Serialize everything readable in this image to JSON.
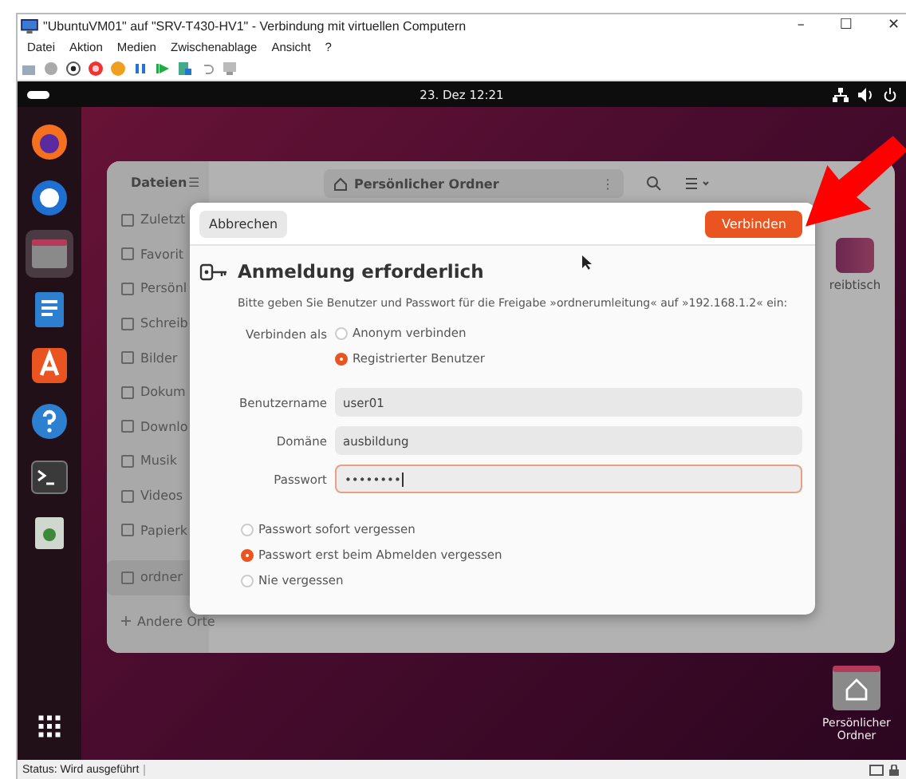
{
  "host_window": {
    "title": "\"UbuntuVM01\" auf \"SRV-T430-HV1\" - Verbindung mit virtuellen Computern",
    "controls": [
      "–",
      "☐",
      "✕"
    ]
  },
  "menu": [
    "Datei",
    "Aktion",
    "Medien",
    "Zwischenablage",
    "Ansicht",
    "?"
  ],
  "topbar": {
    "clock": "23. Dez  12:21"
  },
  "files_window": {
    "title": "Dateien",
    "menu_glyph": "☰",
    "path": "Persönlicher Ordner",
    "more_glyph": "⋮",
    "sidebar": [
      {
        "label": "Zuletzt",
        "selected": false
      },
      {
        "label": "Favorit",
        "selected": false
      },
      {
        "label": "Persönl",
        "selected": false
      },
      {
        "label": "Schreib",
        "selected": false
      },
      {
        "label": "Bilder",
        "selected": false
      },
      {
        "label": "Dokum",
        "selected": false
      },
      {
        "label": "Downlo",
        "selected": false
      },
      {
        "label": "Musik",
        "selected": false
      },
      {
        "label": "Videos",
        "selected": false
      },
      {
        "label": "Papierk",
        "selected": false
      },
      {
        "label": "ordner",
        "selected": true
      }
    ],
    "other_places": "Andere Orte",
    "content_item": "reibtisch"
  },
  "dialog": {
    "cancel": "Abbrechen",
    "confirm": "Verbinden",
    "title": "Anmeldung erforderlich",
    "message": "Bitte geben Sie Benutzer und Passwort für die Freigabe »ordnerumleitung« auf »192.168.1.2« ein:",
    "connect_as_label": "Verbinden als",
    "connect_as": [
      {
        "label": "Anonym verbinden",
        "selected": false
      },
      {
        "label": "Registrierter Benutzer",
        "selected": true
      }
    ],
    "fields": [
      {
        "label": "Benutzername",
        "value": "user01",
        "focused": false
      },
      {
        "label": "Domäne",
        "value": "ausbildung",
        "focused": false
      },
      {
        "label": "Passwort",
        "value": "••••••••",
        "focused": true
      }
    ],
    "remember": [
      {
        "label": "Passwort sofort vergessen",
        "selected": false
      },
      {
        "label": "Passwort erst beim Abmelden vergessen",
        "selected": true
      },
      {
        "label": "Nie vergessen",
        "selected": false
      }
    ]
  },
  "desktop_icon": {
    "label": "Persönlicher Ordner"
  },
  "status_bar": {
    "text": "Status: Wird ausgeführt"
  }
}
